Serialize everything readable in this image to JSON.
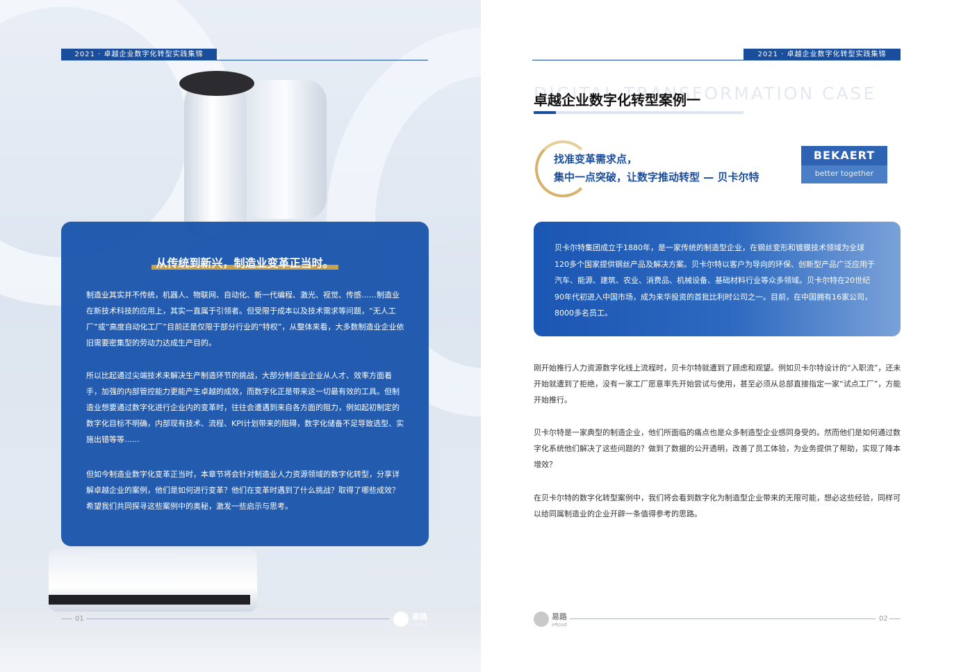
{
  "header": {
    "tag": "2021 · 卓越企业数字化转型实践集锦"
  },
  "left": {
    "card_title": "从传统到新兴，制造业变革正当时。",
    "paragraphs": [
      "制造业其实并不传统，机器人、物联网、自动化、新一代编程、激光、视觉、传感……制造业在新技术科技的应用上，其实一直属于引领者。但受限于成本以及技术需求等问题，“无人工厂”或“高度自动化工厂”目前还是仅限于部分行业的“特权”，从整体来看，大多数制造业企业依旧需要密集型的劳动力达成生产目的。",
      "所以比起通过尖端技术来解决生产制造环节的挑战，大部分制造业企业从人才、效率方面着手，加强的内部管控能力更能产生卓越的成效，而数字化正是带来这一切最有效的工具。但制造业想要通过数字化进行企业内的变革时，往往会遭遇到来自各方面的阻力，例如起初制定的数字化目标不明确，内部现有技术、流程、KPI计划带来的阻碍，数字化储备不足导致选型、实施出错等等……",
      "但如今制造业数字化变革正当时，本章节将会针对制造业人力资源领域的数字化转型，分享详解卓越企业的案例，他们是如何进行变革？他们在变革时遇到了什么挑战？取得了哪些成效？希望我们共同探寻这些案例中的奥秘，激发一些启示与思考。"
    ],
    "page_num": "01"
  },
  "right": {
    "ghost_text": "DIGITAL TRANSFORMATION CASE",
    "title": "卓越企业数字化转型案例一",
    "subtitle_line1": "找准变革需求点，",
    "subtitle_line2": "集中一点突破，让数字推动转型 — 贝卡尔特",
    "brand_name": "BEKAERT",
    "brand_tagline": "better together",
    "card_text": "贝卡尔特集团成立于1880年，是一家传统的制造型企业，在钢丝变形和镀膜技术领域为全球120多个国家提供钢丝产品及解决方案。贝卡尔特以客户为导向的环保、创新型产品广泛应用于汽车、能源、建筑、农业、消费品、机械设备、基础材料行业等众多领域。贝卡尔特在20世纪90年代初进入中国市场，成为来华投资的首批比利时公司之一。目前，在中国拥有16家公司，8000多名员工。",
    "paragraphs": [
      "刚开始推行人力资源数字化线上流程时，贝卡尔特就遭到了顾虑和观望。例如贝卡尔特设计的“入职流”，还未开始就遭到了拒绝，没有一家工厂愿意率先开始尝试与使用，甚至必须从总部直接指定一家“试点工厂”，方能开始推行。",
      "贝卡尔特是一家典型的制造企业，他们所面临的痛点也是众多制造型企业感同身受的。然而他们是如何通过数字化系统他们解决了这些问题的？做到了数据的公开透明，改善了员工体验，为业务提供了帮助，实现了降本增效？",
      "在贝卡尔特的数字化转型案例中，我们将会看到数字化为制造型企业带来的无限可能，想必这些经验，同样可以给同属制造业的企业开辟一条值得参考的思路。"
    ],
    "page_num": "02"
  },
  "footer": {
    "logo_text": "易路",
    "logo_sub": "eRoad"
  },
  "colors": {
    "primary": "#1a4e9c",
    "gold": "#c9a14a"
  }
}
